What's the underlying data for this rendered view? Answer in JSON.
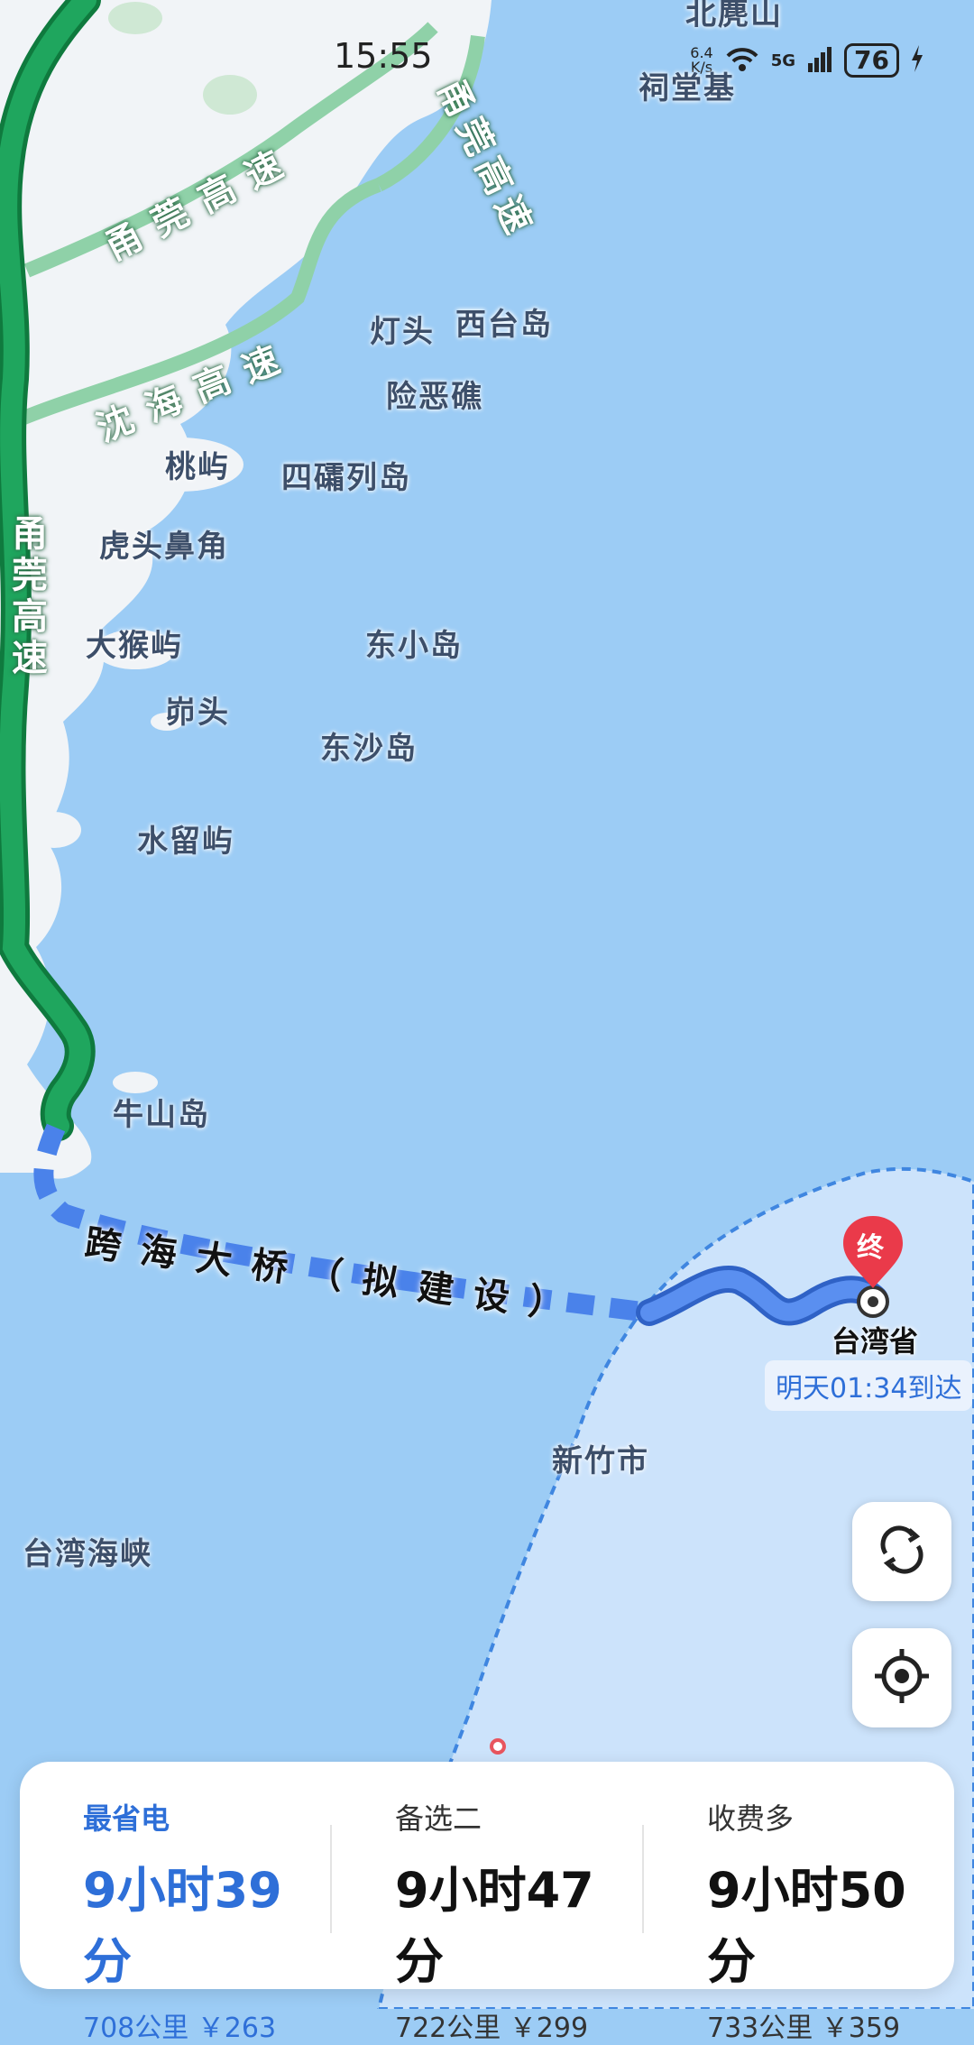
{
  "status_bar": {
    "time": "15:55",
    "speed_value": "6.4",
    "speed_unit": "K/s",
    "network": "5G",
    "battery": "76"
  },
  "map": {
    "places": [
      "北麂山",
      "祠堂基",
      "灯头",
      "西台岛",
      "险恶礁",
      "桃屿",
      "四礵列岛",
      "虎头鼻角",
      "大猴屿",
      "东小岛",
      "峁头",
      "东沙岛",
      "水留屿",
      "牛山岛",
      "新竹市",
      "台湾海峡"
    ],
    "highways": [
      "甬莞高速",
      "甬莞高速",
      "沈海高速",
      "甬莞高速"
    ],
    "bridge_label": "跨海大桥（拟建设）",
    "destination_marker": "终",
    "destination_name": "台湾省",
    "eta": "明天01:34到达"
  },
  "routes": [
    {
      "label": "最省电",
      "time": "9小时39分",
      "distance": "708公里",
      "toll": "￥263",
      "selected": true
    },
    {
      "label": "备选二",
      "time": "9小时47分",
      "distance": "722公里",
      "toll": "￥299",
      "selected": false
    },
    {
      "label": "收费多",
      "time": "9小时50分",
      "distance": "733公里",
      "toll": "￥359",
      "selected": false
    }
  ],
  "colors": {
    "sea": "#9cccf5",
    "land": "#f1f4f7",
    "route_green": "#1e9a57",
    "route_blue": "#4a82ea",
    "accent": "#2e6fd8"
  }
}
